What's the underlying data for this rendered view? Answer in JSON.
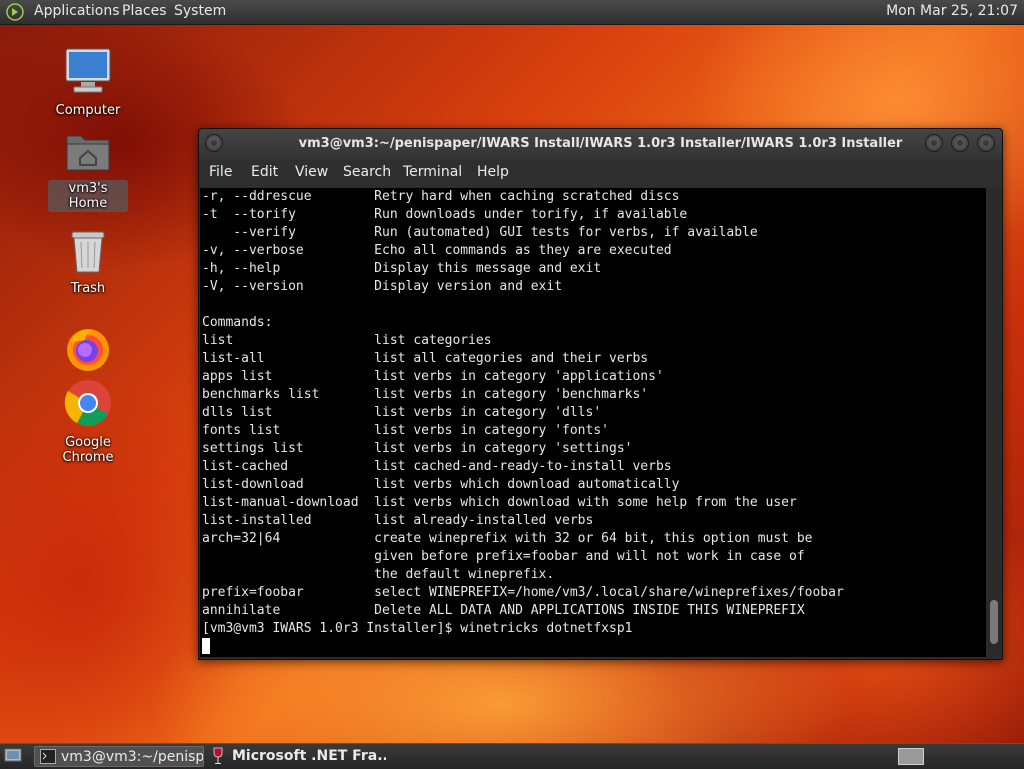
{
  "top_panel": {
    "menus": [
      "Applications",
      "Places",
      "System"
    ],
    "clock": "Mon Mar 25, 21:07"
  },
  "desktop_icons": [
    {
      "label": "Computer",
      "icon": "computer-icon"
    },
    {
      "label": "vm3's Home",
      "icon": "home-folder-icon",
      "selected": true
    },
    {
      "label": "Trash",
      "icon": "trash-icon"
    },
    {
      "label": "",
      "icon": "firefox-icon"
    },
    {
      "label": "Google Chrome",
      "icon": "chrome-icon"
    }
  ],
  "terminal": {
    "title": "vm3@vm3:~/penispaper/IWARS Install/IWARS 1.0r3 Installer/IWARS 1.0r3 Installer",
    "menu": [
      "File",
      "Edit",
      "View",
      "Search",
      "Terminal",
      "Help"
    ],
    "lines": [
      "-r, --ddrescue        Retry hard when caching scratched discs",
      "-t  --torify          Run downloads under torify, if available",
      "    --verify          Run (automated) GUI tests for verbs, if available",
      "-v, --verbose         Echo all commands as they are executed",
      "-h, --help            Display this message and exit",
      "-V, --version         Display version and exit",
      "",
      "Commands:",
      "list                  list categories",
      "list-all              list all categories and their verbs",
      "apps list             list verbs in category 'applications'",
      "benchmarks list       list verbs in category 'benchmarks'",
      "dlls list             list verbs in category 'dlls'",
      "fonts list            list verbs in category 'fonts'",
      "settings list         list verbs in category 'settings'",
      "list-cached           list cached-and-ready-to-install verbs",
      "list-download         list verbs which download automatically",
      "list-manual-download  list verbs which download with some help from the user",
      "list-installed        list already-installed verbs",
      "arch=32|64            create wineprefix with 32 or 64 bit, this option must be",
      "                      given before prefix=foobar and will not work in case of",
      "                      the default wineprefix.",
      "prefix=foobar         select WINEPREFIX=/home/vm3/.local/share/wineprefixes/foobar",
      "annihilate            Delete ALL DATA AND APPLICATIONS INSIDE THIS WINEPREFIX",
      "[vm3@vm3 IWARS 1.0r3 Installer]$ winetricks dotnetfxsp1"
    ]
  },
  "taskbar": {
    "tasks": [
      {
        "label": "vm3@vm3:~/penisp...",
        "icon": "terminal-icon",
        "active": true
      },
      {
        "label": "Microsoft .NET Fra...",
        "icon": "wine-icon",
        "active": false
      }
    ]
  }
}
